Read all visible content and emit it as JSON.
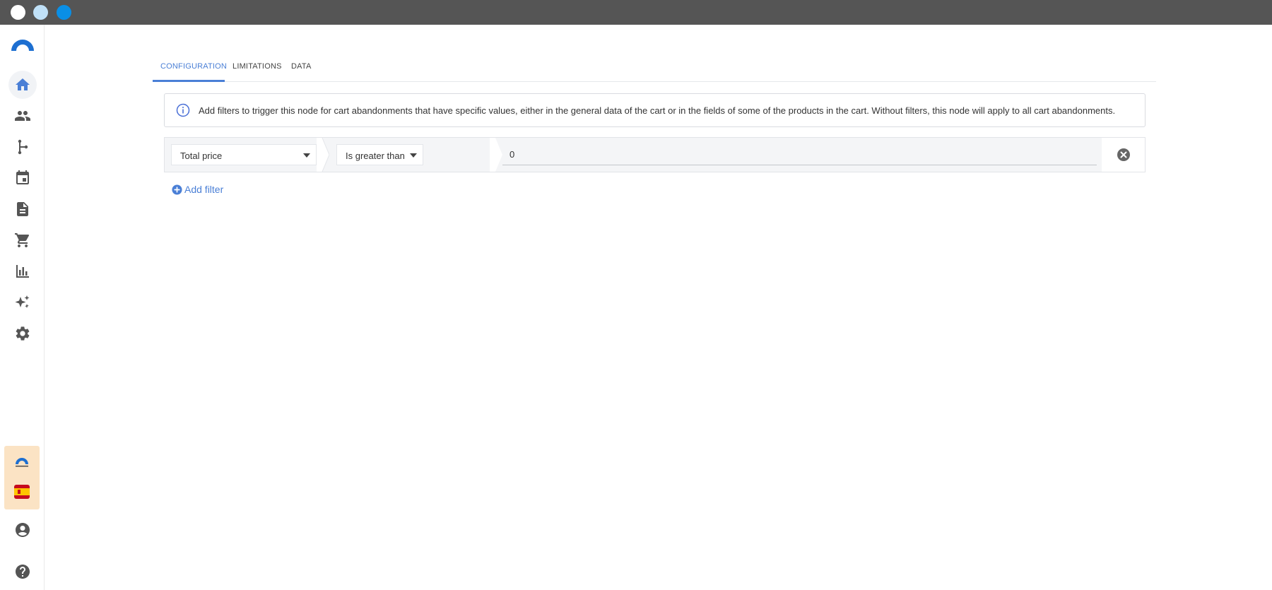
{
  "tabs": [
    {
      "label": "CONFIGURATION",
      "active": true
    },
    {
      "label": "LIMITATIONS",
      "active": false
    },
    {
      "label": "DATA",
      "active": false
    }
  ],
  "info": {
    "text": "Add filters to trigger this node for cart abandonments that have specific values, either in the general data of the cart or in the fields of some of the products in the cart. Without filters, this node will apply to all cart abandonments."
  },
  "filter": {
    "field": "Total price",
    "operator": "Is greater than",
    "value": "0"
  },
  "add_filter_label": "Add filter",
  "sidebar": {
    "items": [
      {
        "icon": "home-icon",
        "active": true
      },
      {
        "icon": "contacts-icon",
        "active": false
      },
      {
        "icon": "workflow-icon",
        "active": false
      },
      {
        "icon": "calendar-icon",
        "active": false
      },
      {
        "icon": "document-icon",
        "active": false
      },
      {
        "icon": "cart-icon",
        "active": false
      },
      {
        "icon": "bar-chart-icon",
        "active": false
      },
      {
        "icon": "sparkle-icon",
        "active": false
      },
      {
        "icon": "settings-icon",
        "active": false
      }
    ],
    "bottom": [
      {
        "icon": "account-icon"
      },
      {
        "icon": "help-icon"
      }
    ]
  },
  "colors": {
    "accent": "#4a7fd6",
    "icon": "#555555",
    "titlebar": "#555555"
  }
}
